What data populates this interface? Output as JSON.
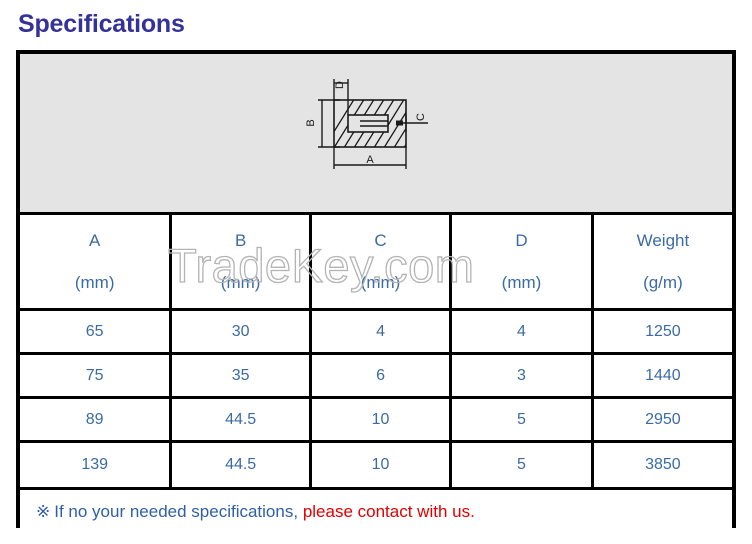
{
  "title": "Specifications",
  "diagram": {
    "name": "profile-cross-section-drawing",
    "labels": {
      "a": "A",
      "b": "B",
      "c": "C",
      "d": "D"
    }
  },
  "table": {
    "headers": [
      {
        "symbol": "A",
        "unit": "(mm)"
      },
      {
        "symbol": "B",
        "unit": "(mm)"
      },
      {
        "symbol": "C",
        "unit": "(mm)"
      },
      {
        "symbol": "D",
        "unit": "(mm)"
      },
      {
        "symbol": "Weight",
        "unit": "(g/m)"
      }
    ],
    "rows": [
      {
        "a": "65",
        "b": "30",
        "c": "4",
        "d": "4",
        "weight": "1250"
      },
      {
        "a": "75",
        "b": "35",
        "c": "6",
        "d": "3",
        "weight": "1440"
      },
      {
        "a": "89",
        "b": "44.5",
        "c": "10",
        "d": "5",
        "weight": "2950"
      },
      {
        "a": "139",
        "b": "44.5",
        "c": "10",
        "d": "5",
        "weight": "3850"
      }
    ]
  },
  "note": {
    "mark": "※",
    "text_blue": "If no your needed specifications,",
    "text_red": "please contact with us."
  },
  "watermark": {
    "text": "TradeKey.com"
  },
  "colors": {
    "title": "#35319a",
    "table_text": "#3b6ba5",
    "note_blue": "#2f5fa8",
    "note_red": "#e00000",
    "border": "#000000",
    "diagram_bg": "#e4e4e4",
    "watermark": "#b4b4b4"
  }
}
